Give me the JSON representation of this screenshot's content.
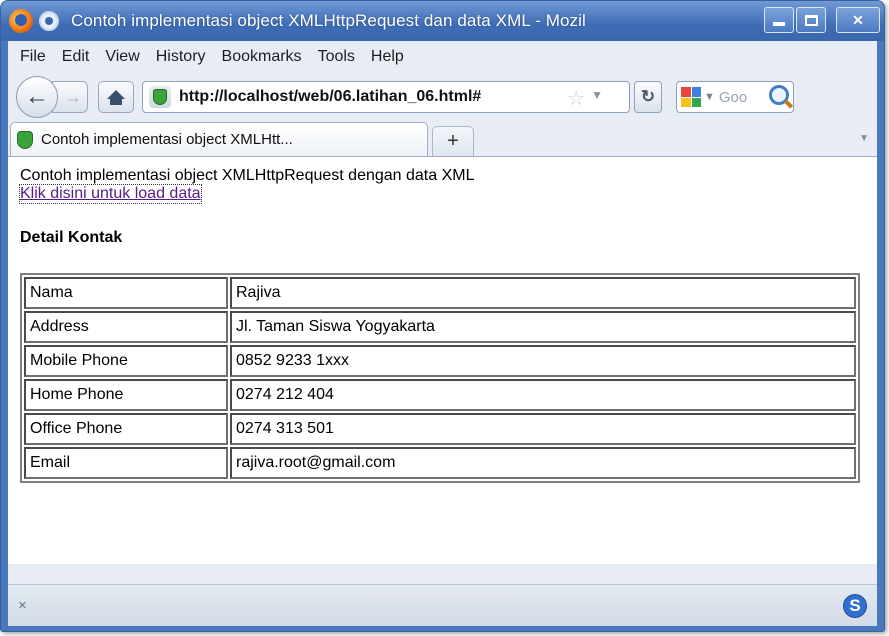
{
  "window": {
    "title": "Contoh implementasi object XMLHttpRequest dan data XML - Mozil",
    "accent": "#4a78bd"
  },
  "menu": [
    "File",
    "Edit",
    "View",
    "History",
    "Bookmarks",
    "Tools",
    "Help"
  ],
  "navbar": {
    "url": "http://localhost/web/06.latihan_06.html#",
    "search_placeholder": "Goo"
  },
  "tabs": [
    {
      "label": "Contoh implementasi object XMLHtt..."
    }
  ],
  "page": {
    "heading": "Contoh implementasi object XMLHttpRequest dengan data XML",
    "link": "Klik disini untuk load data",
    "section_title": "Detail Kontak",
    "rows": [
      {
        "label": "Nama",
        "value": "Rajiva"
      },
      {
        "label": "Address",
        "value": "Jl. Taman Siswa Yogyakarta"
      },
      {
        "label": "Mobile Phone",
        "value": "0852 9233 1xxx"
      },
      {
        "label": "Home Phone",
        "value": "0274 212 404"
      },
      {
        "label": "Office Phone",
        "value": "0274 313 501"
      },
      {
        "label": "Email",
        "value": "rajiva.root@gmail.com"
      }
    ]
  },
  "statusbar": {
    "close_glyph": "×",
    "addon_letter": "S"
  }
}
